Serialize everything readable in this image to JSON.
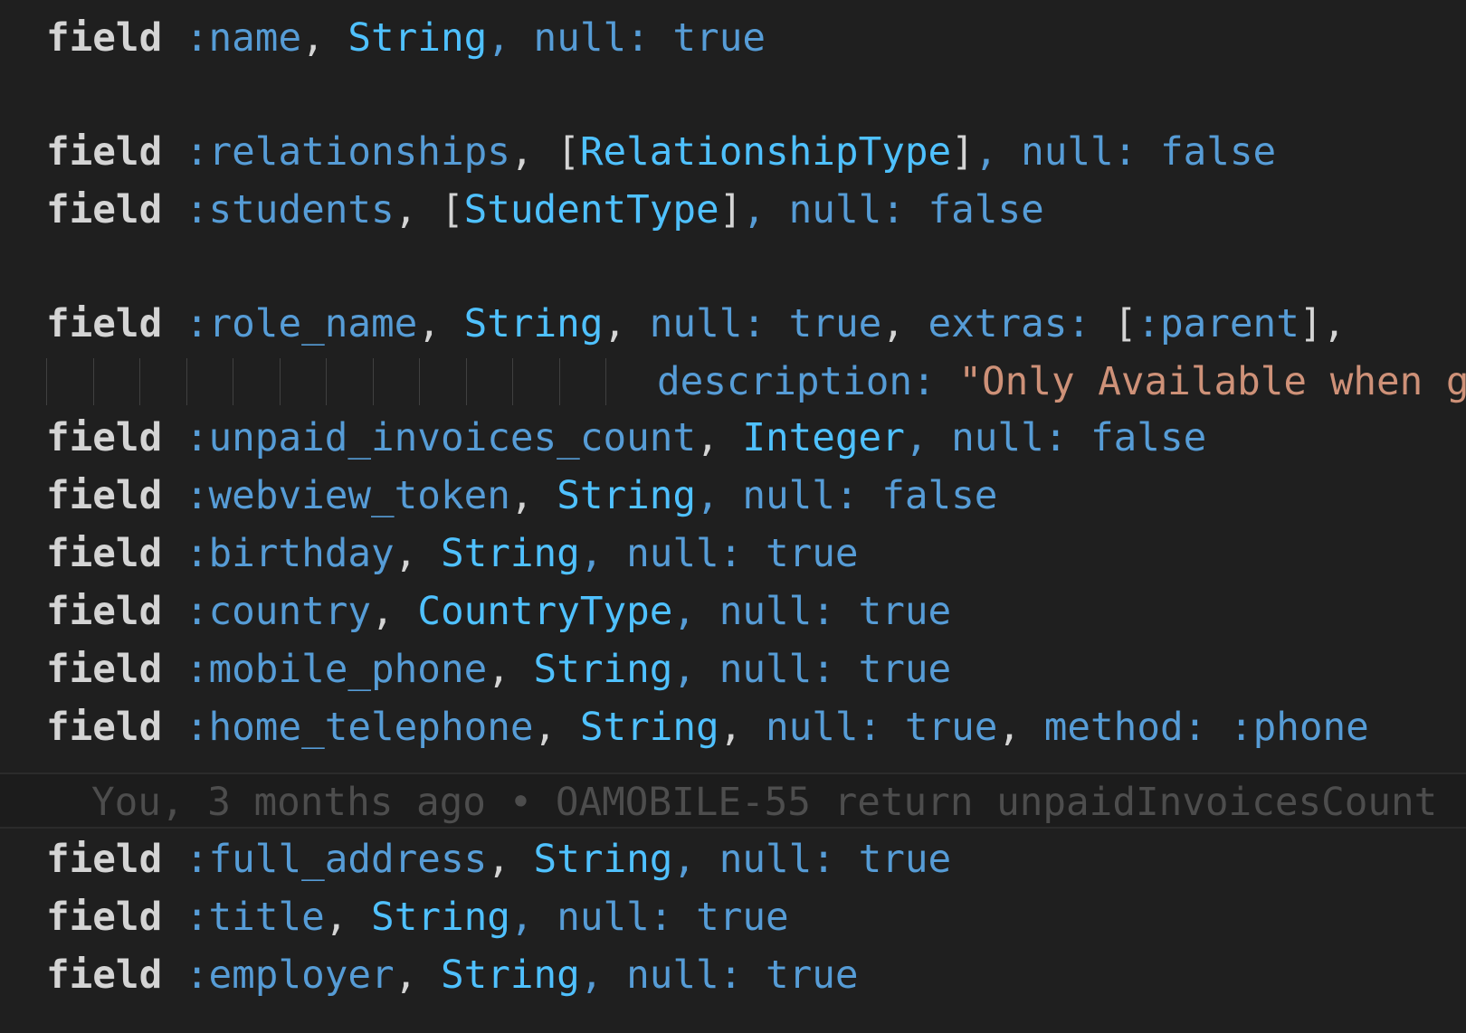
{
  "editor": {
    "lines": [
      {
        "keyword": "field",
        "symbol": ":name",
        "type": "String",
        "rest": ", null: true"
      },
      {
        "keyword": "field",
        "symbol": ":relationships",
        "type_open": "[",
        "type": "RelationshipType",
        "type_close": "]",
        "rest": ", null: false"
      },
      {
        "keyword": "field",
        "symbol": ":students",
        "type_open": "[",
        "type": "StudentType",
        "type_close": "]",
        "rest": ", null: false"
      },
      {
        "keyword": "field",
        "symbol": ":role_name",
        "type": "String",
        "null_key": "null:",
        "null_val": "true",
        "extras_key": "extras:",
        "extras_val": ":parent"
      },
      {
        "description_key": "description:",
        "description_val": "\"Only Available when g"
      },
      {
        "keyword": "field",
        "symbol": ":unpaid_invoices_count",
        "type": "Integer",
        "rest": ", null: false"
      },
      {
        "keyword": "field",
        "symbol": ":webview_token",
        "type": "String",
        "rest": ", null: false"
      },
      {
        "keyword": "field",
        "symbol": ":birthday",
        "type": "String",
        "rest": ", null: true"
      },
      {
        "keyword": "field",
        "symbol": ":country",
        "type": "CountryType",
        "rest": ", null: true"
      },
      {
        "keyword": "field",
        "symbol": ":mobile_phone",
        "type": "String",
        "rest": ", null: true"
      },
      {
        "keyword": "field",
        "symbol": ":home_telephone",
        "type": "String",
        "null_key": "null:",
        "null_val": "true",
        "method_key": "method:",
        "method_val": ":phone"
      },
      {
        "keyword": "field",
        "symbol": ":full_address",
        "type": "String",
        "rest": ", null: true"
      },
      {
        "keyword": "field",
        "symbol": ":title",
        "type": "String",
        "rest": ", null: true"
      },
      {
        "keyword": "field",
        "symbol": ":employer",
        "type": "String",
        "rest": ", null: true"
      }
    ],
    "blame": "You, 3 months ago • OAMOBILE-55 return unpaidInvoicesCount"
  }
}
